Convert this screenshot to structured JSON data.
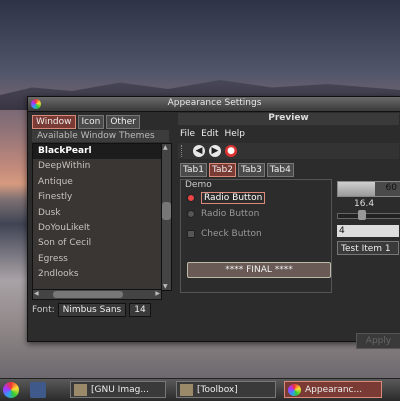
{
  "window": {
    "title": "Appearance Settings",
    "tabs": [
      "Window",
      "Icon",
      "Other"
    ],
    "active_tab": "Window"
  },
  "themes": {
    "header": "Available Window Themes",
    "items": [
      "BlackPearl",
      "DeepWithin",
      "Antique",
      "Finestly",
      "Dusk",
      "DoYouLikeIt",
      "Son of Cecil",
      "Egress",
      "2ndlooks"
    ],
    "selected": "BlackPearl"
  },
  "font": {
    "label": "Font:",
    "name": "Nimbus Sans",
    "size": "14"
  },
  "preview": {
    "title": "Preview",
    "menu": [
      "File",
      "Edit",
      "Help"
    ],
    "tabs": [
      "Tab1",
      "Tab2",
      "Tab3",
      "Tab4"
    ],
    "active_tab": "Tab2",
    "demo": {
      "label": "Demo",
      "radio1": "Radio Button",
      "radio2": "Radio Button",
      "check": "Check Button",
      "final": "**** FINAL ****"
    },
    "progress_text": "60",
    "progress_fraction": 0.6,
    "slider_value": "16.4",
    "spin_value": "4",
    "list_item": "Test Item 1",
    "apply": "Apply"
  },
  "taskbar": {
    "apps": [
      "[GNU Imag...",
      "[Toolbox]",
      "Appearanc..."
    ]
  },
  "colors": {
    "accent": "#7a3b34",
    "accent_border": "#d98a7a",
    "stop": "#dd3333"
  }
}
